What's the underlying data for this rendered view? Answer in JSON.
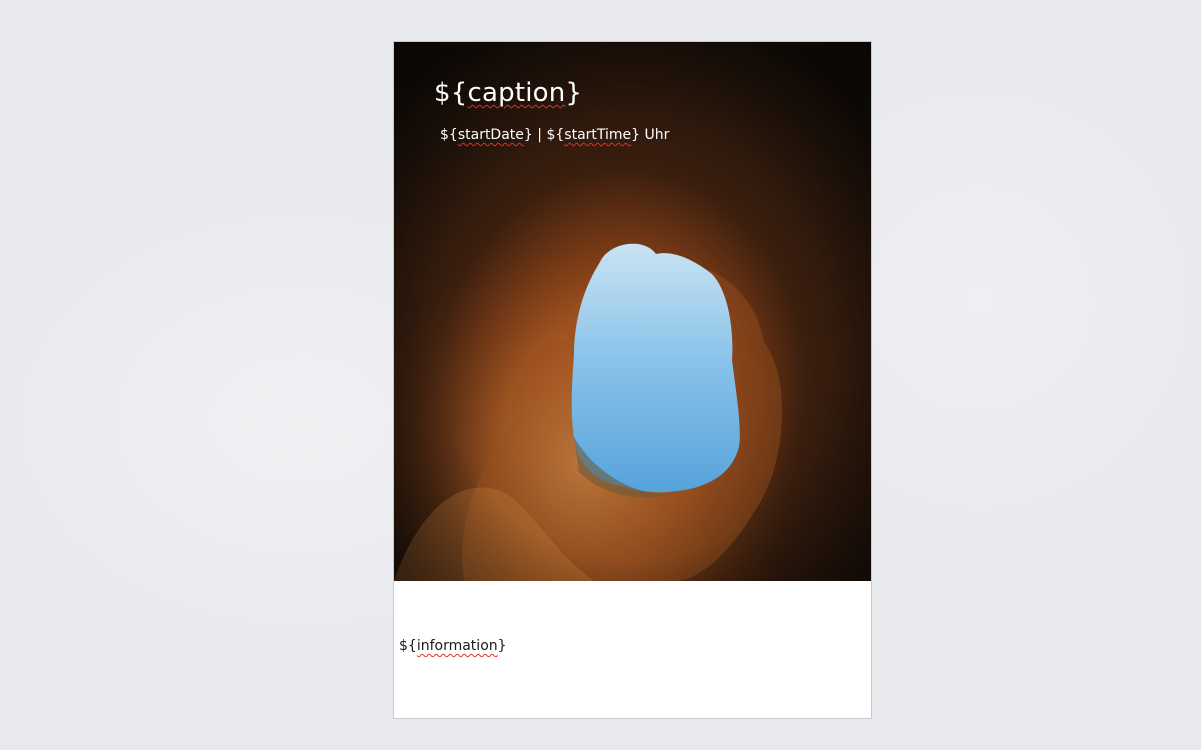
{
  "document": {
    "cover": {
      "caption_prefix": "${",
      "caption_word": "caption",
      "caption_suffix": "}",
      "start_date_prefix": "${",
      "start_date_word": "startDate",
      "start_date_suffix": "}",
      "separator": " | ",
      "start_time_prefix": "${",
      "start_time_word": "startTime",
      "start_time_suffix": "}",
      "time_unit": " Uhr",
      "image_icon": "cave-opening-sky-photo"
    },
    "body": {
      "information_prefix": "${",
      "information_word": "information",
      "information_suffix": "}"
    }
  },
  "colors": {
    "canvas": "#e8e9ed",
    "page": "#ffffff",
    "spellcheck_underline": "#e0302a"
  }
}
